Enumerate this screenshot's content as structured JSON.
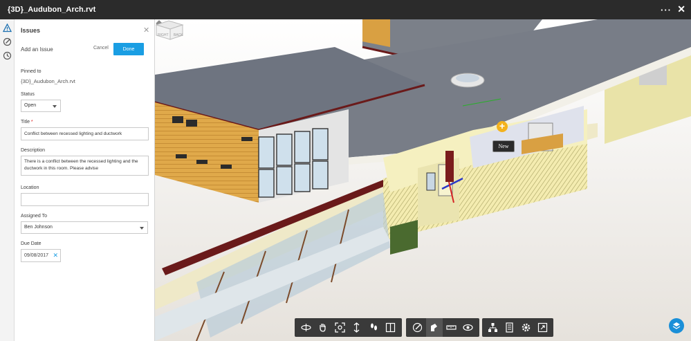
{
  "window": {
    "title": "{3D}_Audubon_Arch.rvt"
  },
  "panel": {
    "header": "Issues",
    "subheader": "Add an Issue",
    "cancel_label": "Cancel",
    "done_label": "Done",
    "pinned_label": "Pinned to",
    "pinned_value": "{3D}_Audubon_Arch.rvt",
    "status_label": "Status",
    "status_value": "Open",
    "title_label": "Title",
    "title_required": "*",
    "title_value": "Conflict between recessed lighting and ductwork",
    "description_label": "Description",
    "description_value": "There is a conflict between the recessed lighting and the ductwork in this room. Please advise",
    "location_label": "Location",
    "location_value": "",
    "assigned_label": "Assigned To",
    "assigned_value": "Ben Johnson",
    "due_label": "Due Date",
    "due_value": "09/08/2017"
  },
  "viewport": {
    "pin_tooltip": "New",
    "viewcube_labels": [
      "RIGHT",
      "BACK"
    ]
  },
  "toolbar": {
    "groups": [
      [
        "orbit-icon",
        "pan-icon",
        "zoom-fit-icon",
        "zoom-icon",
        "first-person-icon",
        "section-icon"
      ],
      [
        "markup-icon",
        "pin-issue-icon",
        "measure-icon",
        "explode-view-icon"
      ],
      [
        "model-browser-icon",
        "properties-icon",
        "settings-icon",
        "fullscreen-icon"
      ]
    ],
    "active_tool": "pin-issue-icon"
  },
  "colors": {
    "accent": "#1a9ee3",
    "titlebar": "#2b2b2b",
    "roof": "#6e7480",
    "wall_wood": "#d9a042",
    "trim": "#6a1a1a",
    "pin": "#f3b21d"
  }
}
